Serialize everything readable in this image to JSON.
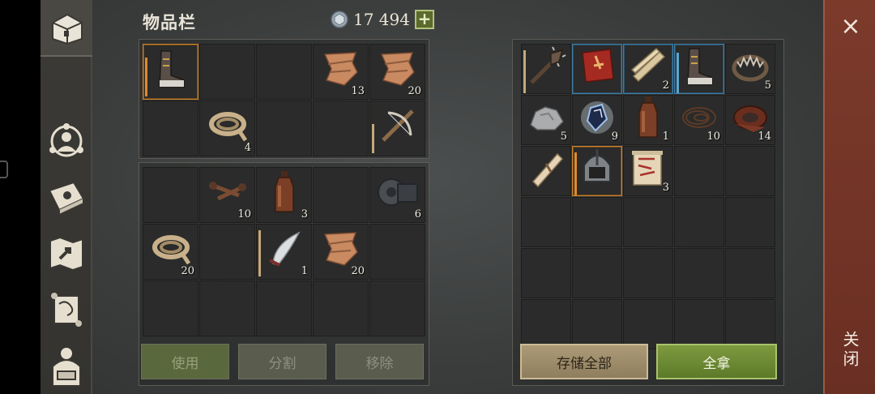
{
  "header": {
    "title": "物品栏",
    "currency_amount": "17 494",
    "plus_label": "+"
  },
  "sidebar": {
    "tabs": [
      {
        "name": "inventory-chest",
        "active": true
      },
      {
        "name": "character"
      },
      {
        "name": "crafting-book"
      },
      {
        "name": "map"
      },
      {
        "name": "quests-scroll"
      },
      {
        "name": "backpack"
      }
    ]
  },
  "inventory_top": [
    {
      "item": "boots-icon",
      "selected": true,
      "bar": 0.8
    },
    {},
    {},
    {
      "item": "cloth-icon",
      "qty": "13"
    },
    {
      "item": "cloth-icon",
      "qty": "20"
    },
    {},
    {
      "item": "rope-icon",
      "qty": "4"
    },
    {},
    {},
    {
      "item": "crossbow-icon",
      "bar": 0.6,
      "bar_style": "tan"
    }
  ],
  "inventory_bottom": [
    {},
    {
      "item": "nails-icon",
      "qty": "10"
    },
    {
      "item": "bottle-icon",
      "qty": "3"
    },
    {},
    {
      "item": "gear-part-icon",
      "qty": "6"
    },
    {
      "item": "rope-icon",
      "qty": "20"
    },
    {},
    {
      "item": "scimitar-icon",
      "qty": "1",
      "bar": 0.95,
      "bar_style": "tan"
    },
    {
      "item": "cloth-icon",
      "qty": "20"
    },
    {},
    {},
    {},
    {},
    {},
    {}
  ],
  "buttons_left": {
    "use": "使用",
    "split": "分割",
    "remove": "移除"
  },
  "storage": [
    {
      "item": "spiked-club-icon",
      "bar": 0.95,
      "bar_style": "tan"
    },
    {
      "item": "red-book-icon",
      "blue": true
    },
    {
      "item": "planks-icon",
      "qty": "2",
      "blue": true
    },
    {
      "item": "boots-icon",
      "blue": true,
      "bar": 0.9,
      "bar_style": "blue"
    },
    {
      "item": "bear-trap-icon",
      "qty": "5"
    },
    {
      "item": "stone-icon",
      "qty": "5"
    },
    {
      "item": "crystal-icon",
      "qty": "9"
    },
    {
      "item": "bottle-icon",
      "qty": "1"
    },
    {
      "item": "wire-icon",
      "qty": "10"
    },
    {
      "item": "leather-icon",
      "qty": "14"
    },
    {
      "item": "paper-roll-icon"
    },
    {
      "item": "helmet-icon",
      "selected": true,
      "bar": 0.95
    },
    {
      "item": "map-scroll-icon",
      "qty": "3"
    },
    {},
    {},
    {},
    {},
    {},
    {},
    {},
    {},
    {},
    {},
    {},
    {},
    {},
    {},
    {},
    {},
    {}
  ],
  "buttons_right": {
    "store_all": "存储全部",
    "take_all": "全拿"
  },
  "close": {
    "x": "×",
    "label": "关闭"
  }
}
